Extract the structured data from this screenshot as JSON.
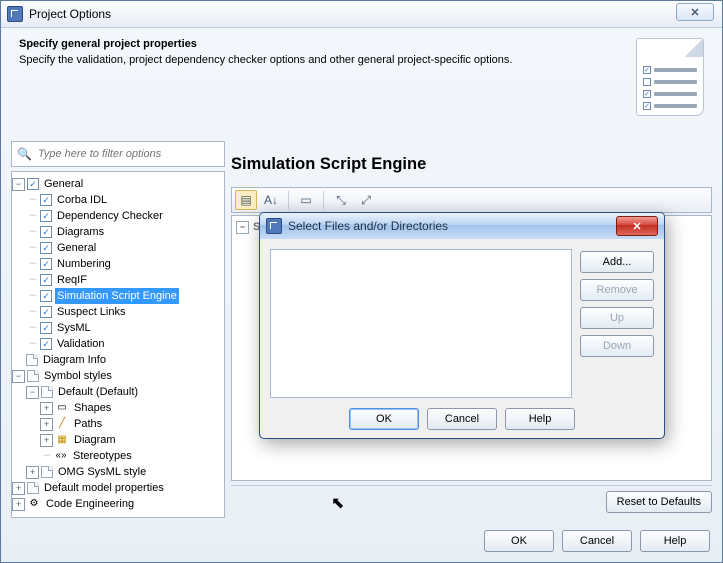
{
  "window": {
    "title": "Project Options",
    "close_glyph": "✕"
  },
  "header": {
    "title": "Specify general project properties",
    "desc": "Specify the validation, project dependency checker options and other general project-specific options."
  },
  "filter": {
    "placeholder": "Type here to filter options"
  },
  "tree": {
    "general": "General",
    "items": {
      "corba": "Corba IDL",
      "depchk": "Dependency Checker",
      "diagrams": "Diagrams",
      "general2": "General",
      "numbering": "Numbering",
      "reqif": "ReqIF",
      "simscript": "Simulation Script Engine",
      "suspect": "Suspect Links",
      "sysml": "SysML",
      "validation": "Validation"
    },
    "diagram_info": "Diagram Info",
    "symbol_styles": "Symbol styles",
    "default_style": "Default (Default)",
    "shapes": "Shapes",
    "paths": "Paths",
    "diagram": "Diagram",
    "stereotypes": "Stereotypes",
    "omg": "OMG SysML style",
    "defmodel": "Default model properties",
    "codeeng": "Code Engineering"
  },
  "right": {
    "heading": "Simulation Script Engine",
    "group_title": "Simulation Script Engine"
  },
  "modal": {
    "title": "Select Files and/or Directories",
    "add": "Add...",
    "remove": "Remove",
    "up": "Up",
    "down": "Down",
    "ok": "OK",
    "cancel": "Cancel",
    "help": "Help"
  },
  "footer": {
    "reset": "Reset to Defaults",
    "ok": "OK",
    "cancel": "Cancel",
    "help": "Help"
  },
  "glyph": {
    "minus": "−",
    "plus": "+",
    "check": "✓",
    "search": "🔍",
    "x": "✕",
    "cursor": "↖"
  },
  "tb": {
    "cats": "▤",
    "az": "A↓",
    "row": "▭",
    "expand": "⤡",
    "collapse": "⤢"
  }
}
